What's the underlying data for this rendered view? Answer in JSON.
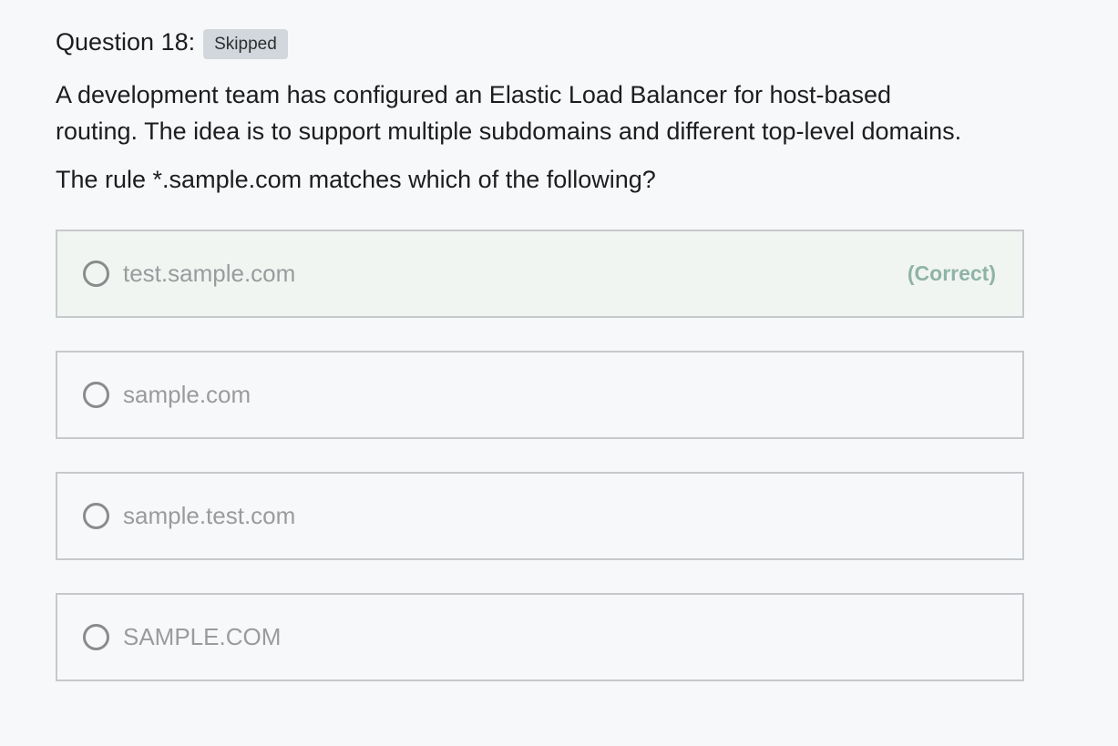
{
  "question": {
    "title": "Question 18:",
    "status_badge": "Skipped",
    "text": "A development team has configured an Elastic Load Balancer for host-based routing. The idea is to support multiple subdomains and different top-level domains.",
    "prompt": "The rule *.sample.com matches which of the following?"
  },
  "answers": [
    {
      "text": "test.sample.com",
      "label": "(Correct)"
    },
    {
      "text": "sample.com"
    },
    {
      "text": "sample.test.com"
    },
    {
      "text": "SAMPLE.COM"
    }
  ],
  "colors": {
    "background": "#f7f8fa",
    "badge_bg": "#d1d7dc",
    "correct_bg": "#f1f5f2",
    "correct_label": "#8fb3a7",
    "border": "#c6c9cc"
  }
}
